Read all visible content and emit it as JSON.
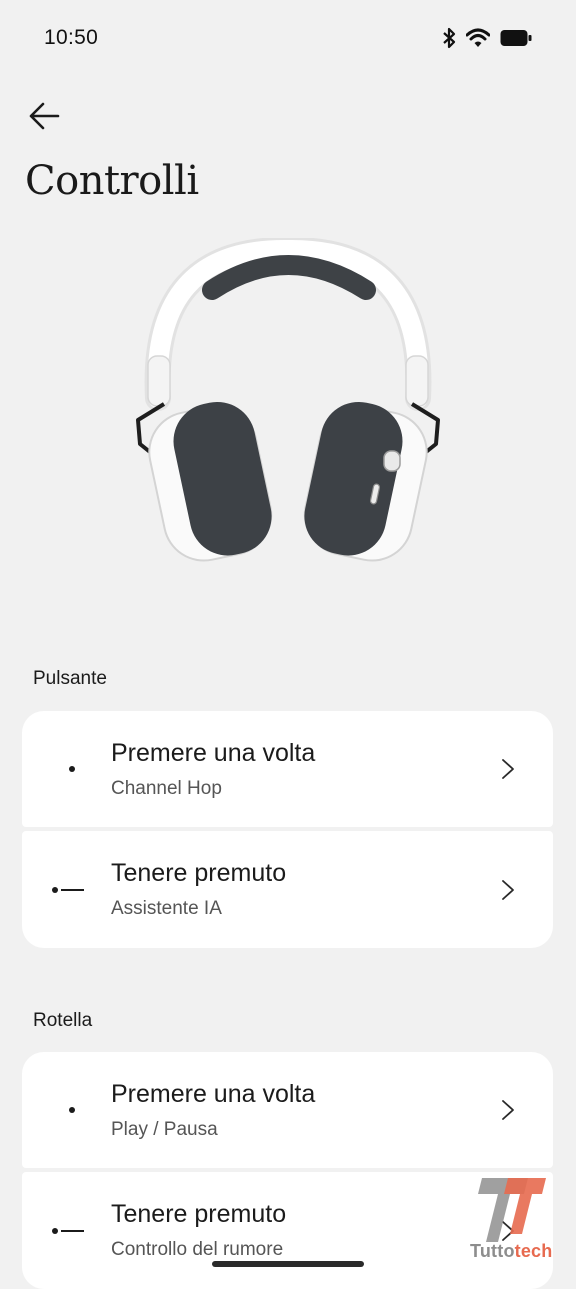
{
  "status_bar": {
    "time": "10:50",
    "icons": [
      "bluetooth-icon",
      "wifi-icon",
      "battery-icon"
    ]
  },
  "header": {
    "back_icon": "arrow-left-icon",
    "title": "Controlli"
  },
  "hero_image": "headphones-image",
  "sections": [
    {
      "label": "Pulsante",
      "items": [
        {
          "title": "Premere una volta",
          "value": "Channel Hop",
          "gesture_icon": "single-press-icon"
        },
        {
          "title": "Tenere premuto",
          "value": "Assistente IA",
          "gesture_icon": "long-press-icon"
        }
      ]
    },
    {
      "label": "Rotella",
      "items": [
        {
          "title": "Premere una volta",
          "value": "Play / Pausa",
          "gesture_icon": "single-press-icon"
        },
        {
          "title": "Tenere premuto",
          "value": "Controllo del rumore",
          "gesture_icon": "long-press-icon"
        }
      ]
    }
  ],
  "watermark": {
    "part1": "Tutto",
    "part2": "tech"
  },
  "colors": {
    "background": "#f1f1f1",
    "card": "#ffffff",
    "text": "#1b1b1b",
    "watermark_accent": "#e76a4f"
  }
}
